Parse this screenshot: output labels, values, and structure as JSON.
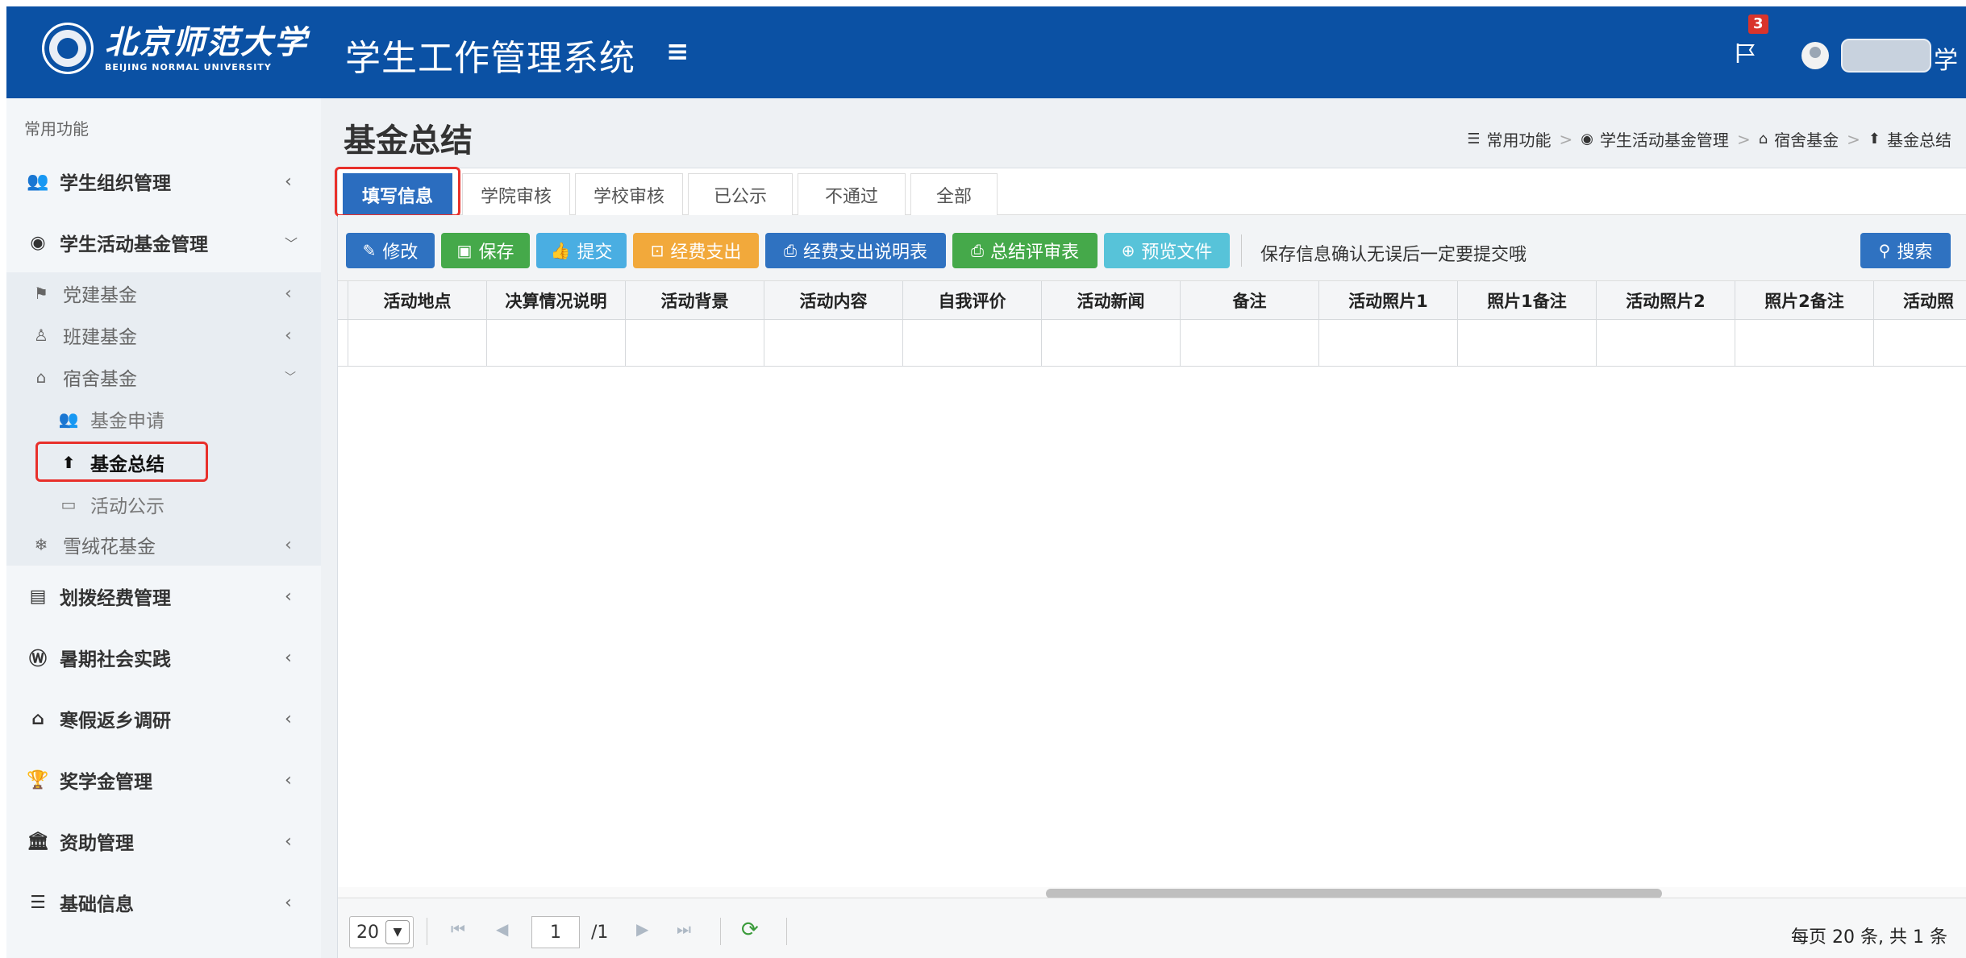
{
  "header": {
    "logo_cn": "北京师范大学",
    "logo_en": "BEIJING NORMAL UNIVERSITY",
    "system_title": "学生工作管理系统",
    "notification_count": "3",
    "username": "学",
    "colors": {
      "primary": "#0b51a4",
      "badge": "#d9342b"
    }
  },
  "sidebar": {
    "section_label": "常用功能",
    "items": [
      {
        "icon": "users-icon",
        "label": "学生组织管理"
      },
      {
        "icon": "compass-icon",
        "label": "学生活动基金管理"
      },
      {
        "icon": "list-icon",
        "label": "划拨经费管理"
      },
      {
        "icon": "wordpress-icon",
        "label": "暑期社会实践"
      },
      {
        "icon": "home-icon",
        "label": "寒假返乡调研"
      },
      {
        "icon": "trophy-icon",
        "label": "奖学金管理"
      },
      {
        "icon": "bank-icon",
        "label": "资助管理"
      },
      {
        "icon": "database-icon",
        "label": "基础信息"
      }
    ],
    "fund_subitems": [
      {
        "icon": "flag-icon",
        "label": "党建基金"
      },
      {
        "icon": "user-icon",
        "label": "班建基金"
      },
      {
        "icon": "home-icon",
        "label": "宿舍基金"
      },
      {
        "icon": "snowflake-icon",
        "label": "雪绒花基金"
      }
    ],
    "dorm_subitems": [
      {
        "icon": "users-icon",
        "label": "基金申请"
      },
      {
        "icon": "upload-icon",
        "label": "基金总结"
      },
      {
        "icon": "desktop-icon",
        "label": "活动公示"
      }
    ]
  },
  "page": {
    "title": "基金总结",
    "breadcrumb": [
      "常用功能",
      "学生活动基金管理",
      "宿舍基金",
      "基金总结"
    ]
  },
  "tabs": [
    "填写信息",
    "学院审核",
    "学校审核",
    "已公示",
    "不通过",
    "全部"
  ],
  "toolbar": {
    "edit": "修改",
    "save": "保存",
    "submit": "提交",
    "expense": "经费支出",
    "expense_sheet": "经费支出说明表",
    "review_sheet": "总结评审表",
    "preview": "预览文件",
    "notice": "保存信息确认无误后一定要提交哦",
    "search": "搜索"
  },
  "table": {
    "columns": [
      "活动地点",
      "决算情况说明",
      "活动背景",
      "活动内容",
      "自我评价",
      "活动新闻",
      "备注",
      "活动照片1",
      "照片1备注",
      "活动照片2",
      "照片2备注",
      "活动照"
    ]
  },
  "pager": {
    "page_size": "20",
    "current_page": "1",
    "total_pages": "/1",
    "info": "每页 20 条, 共 1 条"
  }
}
